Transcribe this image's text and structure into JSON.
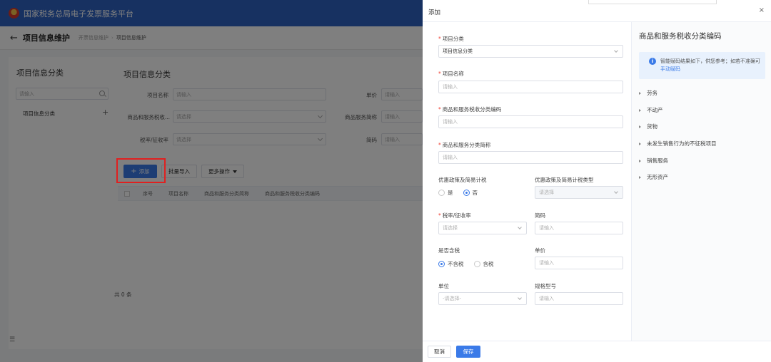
{
  "app": {
    "platform_title": "国家税务总局电子发票服务平台",
    "page_title": "项目信息维护",
    "breadcrumb": [
      "开票信息维护",
      "项目信息维护"
    ]
  },
  "left_panel": {
    "title": "项目信息分类",
    "search_placeholder": "请输入",
    "tree_item": "项目信息分类"
  },
  "main_panel": {
    "title": "项目信息分类",
    "filters": [
      {
        "label": "项目名称",
        "placeholder": "请输入"
      },
      {
        "label": "单价",
        "placeholder": "请输入"
      },
      {
        "label": "商品和服务税收...",
        "placeholder": "请选择"
      },
      {
        "label": "商品服务简称",
        "placeholder": "请输入"
      },
      {
        "label": "税率/征收率",
        "placeholder": "请选择"
      },
      {
        "label": "简码",
        "placeholder": "请输入"
      }
    ],
    "buttons": {
      "add": "添加",
      "batch_import": "批量导入",
      "more_ops": "更多操作"
    },
    "table_headers": [
      "序号",
      "项目名称",
      "商品和服务分类简称",
      "商品和服务税收分类编码"
    ],
    "total_text": "共 0 条"
  },
  "drawer": {
    "title": "添加",
    "fields": {
      "category": {
        "label": "项目分类",
        "value": "项目信息分类"
      },
      "name": {
        "label": "项目名称",
        "placeholder": "请输入"
      },
      "tax_code": {
        "label": "商品和服务税收分类编码",
        "placeholder": "请输入"
      },
      "short_name": {
        "label": "商品和服务分类简称",
        "placeholder": "请输入"
      },
      "preferential": {
        "label": "优惠政策及简易计税",
        "options": [
          "是",
          "否"
        ],
        "selected": "否"
      },
      "preferential_type": {
        "label": "优惠政策及简易计税类型",
        "placeholder": "请选择"
      },
      "tax_rate": {
        "label": "税率/征收率",
        "placeholder": "请选择"
      },
      "short_code": {
        "label": "简码",
        "placeholder": "请输入"
      },
      "tax_included": {
        "label": "是否含税",
        "options": [
          "不含税",
          "含税"
        ],
        "selected": "不含税"
      },
      "unit_price": {
        "label": "单价",
        "placeholder": "请输入"
      },
      "unit": {
        "label": "单位",
        "placeholder": "-请选择-"
      },
      "spec": {
        "label": "规格型号",
        "placeholder": "请输入"
      }
    },
    "side": {
      "title": "商品和服务税收分类编码",
      "info_text": "智能赋码结果如下，供您参考；如若不准确可",
      "info_link": "手动赋码",
      "categories": [
        "劳务",
        "不动产",
        "货物",
        "未发生销售行为的不征税项目",
        "销售服务",
        "无形资产"
      ]
    },
    "footer": {
      "cancel": "取消",
      "save": "保存"
    }
  },
  "colors": {
    "brand_blue": "#2e62c2",
    "primary": "#3a7ae8",
    "required": "#f04134",
    "highlight": "#e02020"
  }
}
